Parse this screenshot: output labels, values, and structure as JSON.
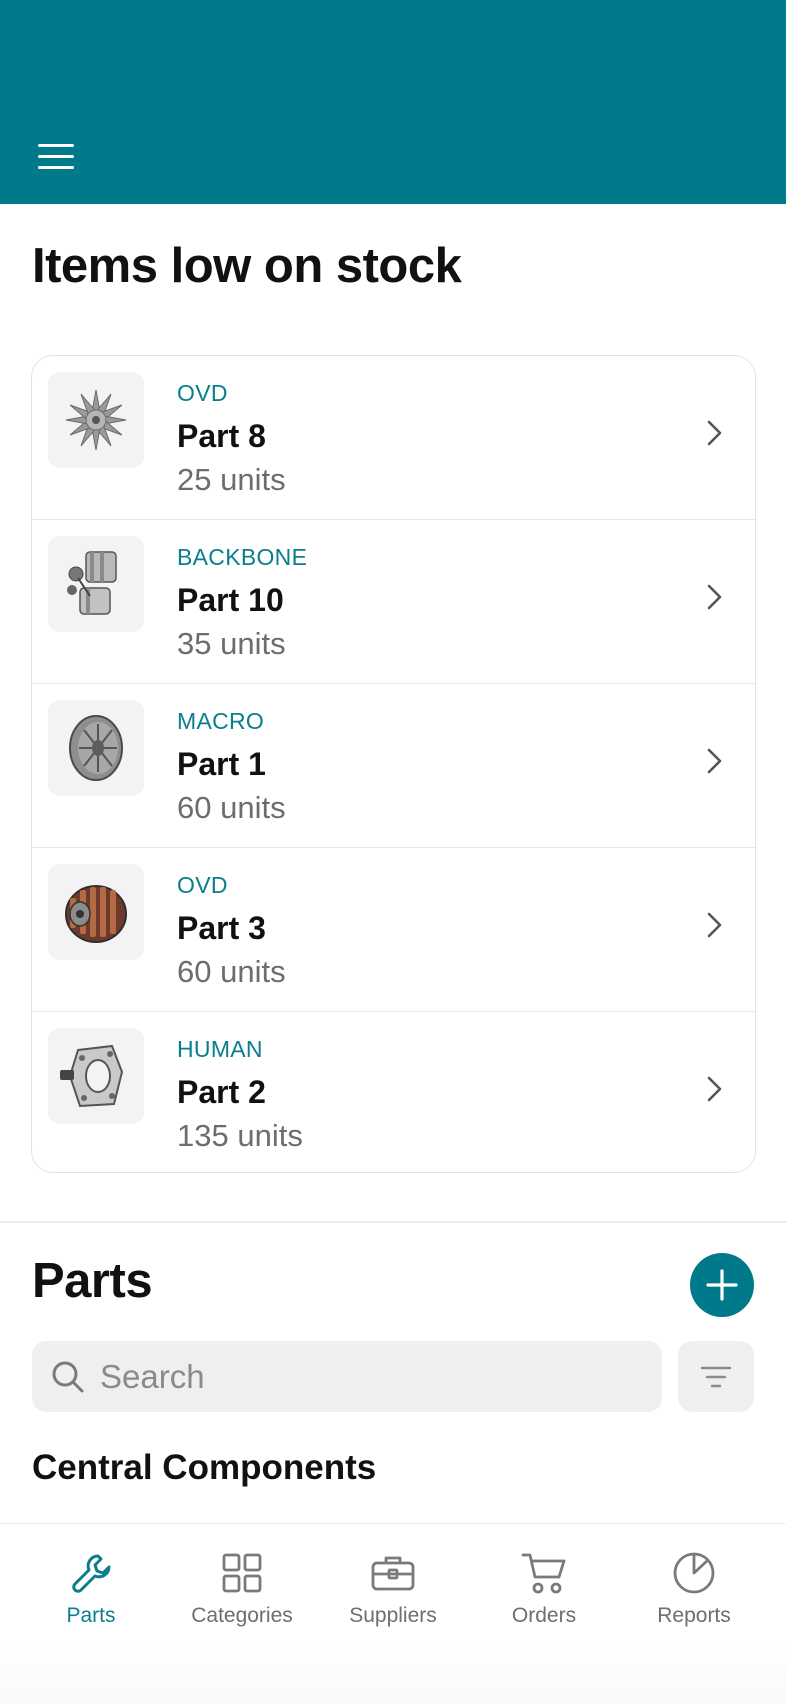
{
  "low_stock": {
    "title": "Items low on stock",
    "items": [
      {
        "category": "OVD",
        "name": "Part 8",
        "units": "25 units",
        "thumb_icon": "fan-part-icon"
      },
      {
        "category": "BACKBONE",
        "name": "Part 10",
        "units": "35 units",
        "thumb_icon": "motor-assembly-icon"
      },
      {
        "category": "MACRO",
        "name": "Part 1",
        "units": "60 units",
        "thumb_icon": "disc-part-icon"
      },
      {
        "category": "OVD",
        "name": "Part 3",
        "units": "60 units",
        "thumb_icon": "rotor-part-icon"
      },
      {
        "category": "HUMAN",
        "name": "Part 2",
        "units": "135 units",
        "thumb_icon": "bracket-part-icon"
      }
    ]
  },
  "parts": {
    "title": "Parts",
    "search_placeholder": "Search",
    "group_title": "Central Components"
  },
  "nav": {
    "items": [
      {
        "label": "Parts",
        "icon": "wrench-icon",
        "active": true
      },
      {
        "label": "Categories",
        "icon": "grid-icon",
        "active": false
      },
      {
        "label": "Suppliers",
        "icon": "toolbox-icon",
        "active": false
      },
      {
        "label": "Orders",
        "icon": "cart-icon",
        "active": false
      },
      {
        "label": "Reports",
        "icon": "pie-chart-icon",
        "active": false
      }
    ]
  },
  "colors": {
    "accent": "#007A8A",
    "accent_text": "#0A7E8C",
    "muted_text": "#6d6d6d",
    "search_bg": "#efefef"
  }
}
